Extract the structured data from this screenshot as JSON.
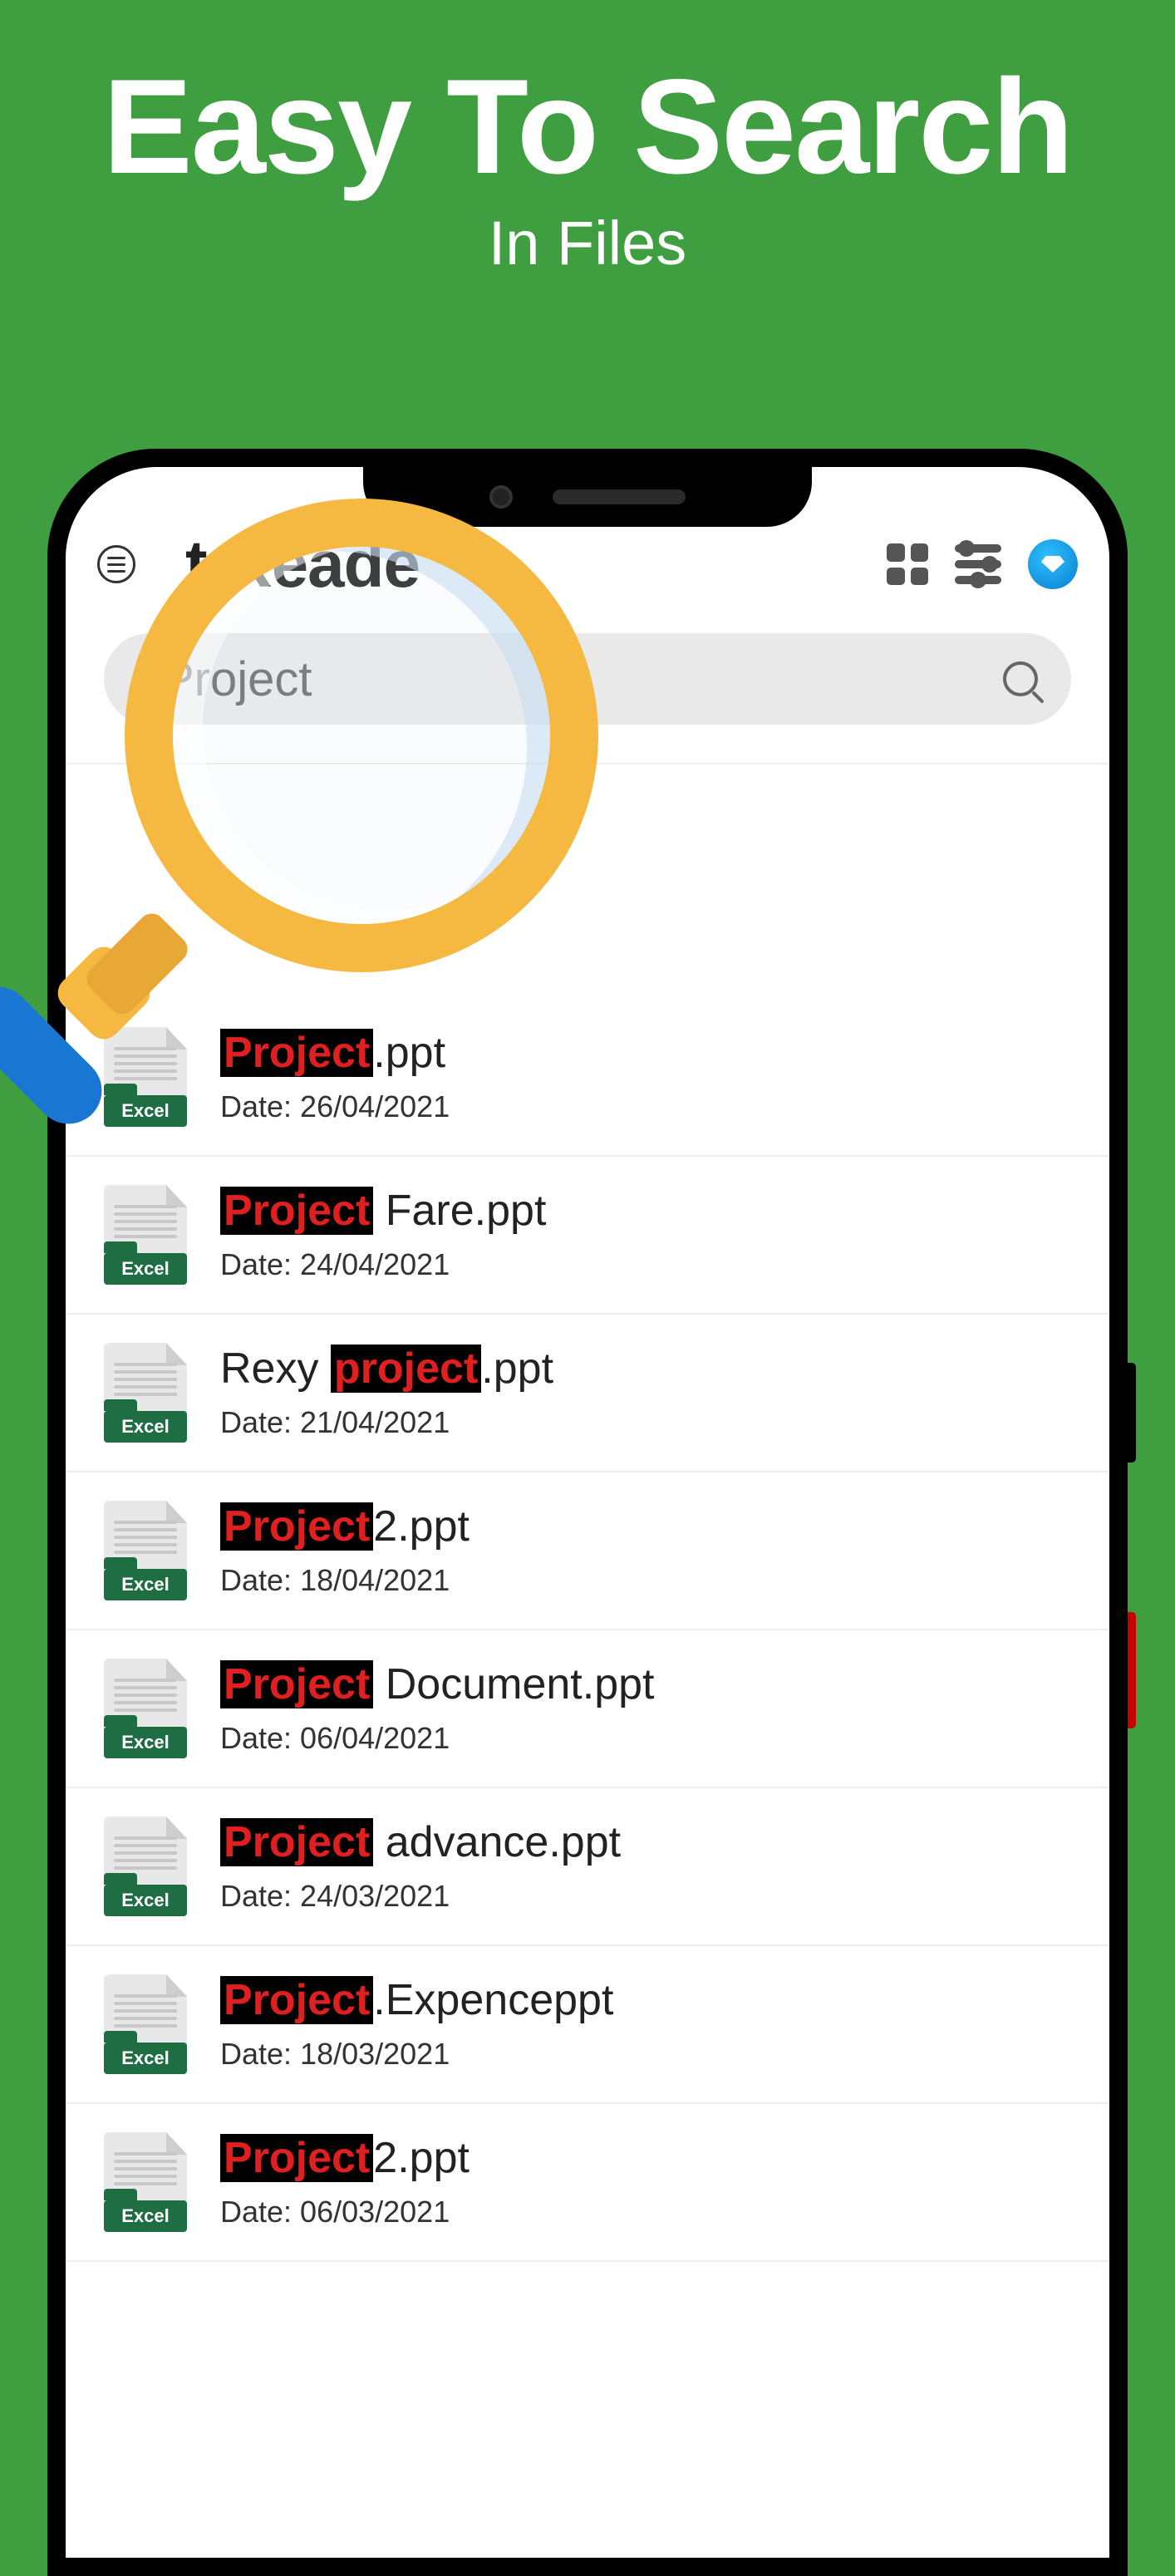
{
  "hero": {
    "title": "Easy To Search",
    "subtitle": "In Files"
  },
  "app": {
    "title": "t Reade"
  },
  "search": {
    "query": "Project"
  },
  "file_badge_label": "Excel",
  "date_prefix": "Date: ",
  "files": [
    {
      "pre": "",
      "hl": "Project",
      "post": ".ppt",
      "date": "26/04/2021"
    },
    {
      "pre": "",
      "hl": "Project",
      "post": " Fare.ppt",
      "date": "24/04/2021"
    },
    {
      "pre": "Rexy ",
      "hl": "project",
      "post": ".ppt",
      "date": "21/04/2021"
    },
    {
      "pre": "",
      "hl": "Project",
      "post": "2.ppt",
      "date": "18/04/2021"
    },
    {
      "pre": "",
      "hl": "Project",
      "post": " Document.ppt",
      "date": "06/04/2021"
    },
    {
      "pre": "",
      "hl": "Project",
      "post": " advance.ppt",
      "date": "24/03/2021"
    },
    {
      "pre": "",
      "hl": "Project",
      "post": ".Expenceppt",
      "date": "18/03/2021"
    },
    {
      "pre": "",
      "hl": "Project",
      "post": "2.ppt",
      "date": "06/03/2021"
    }
  ]
}
